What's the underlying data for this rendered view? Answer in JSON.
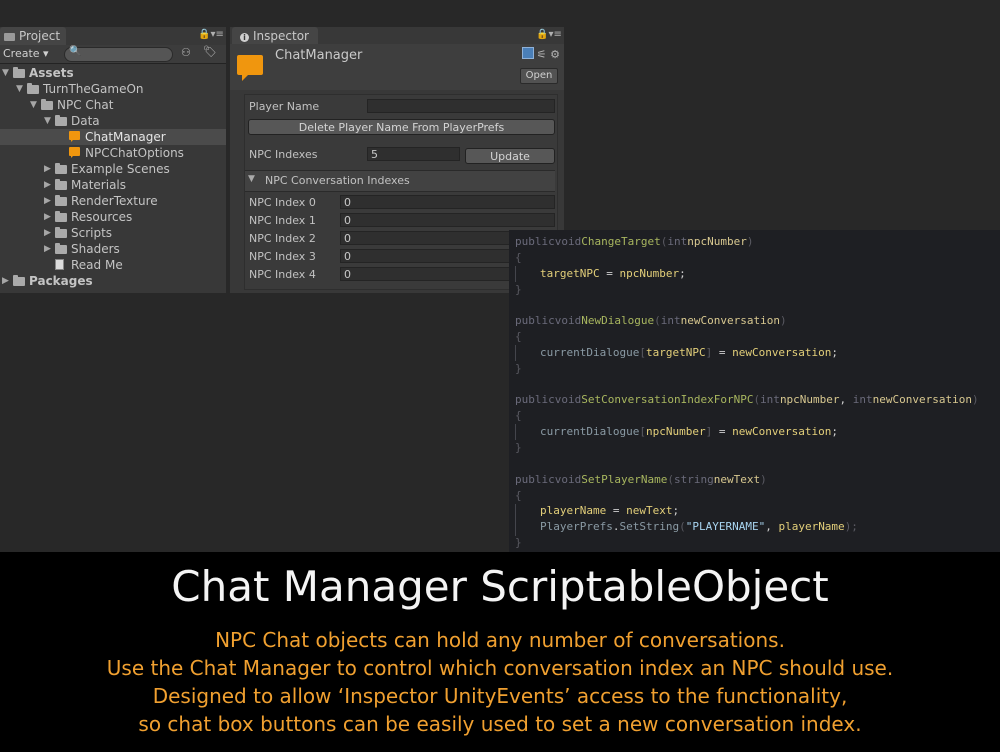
{
  "project": {
    "tab_label": "Project",
    "create_label": "Create",
    "tree": [
      {
        "label": "Assets",
        "depth": 0,
        "type": "folder",
        "bold": true
      },
      {
        "label": "TurnTheGameOn",
        "depth": 1,
        "type": "folder"
      },
      {
        "label": "NPC Chat",
        "depth": 2,
        "type": "folder"
      },
      {
        "label": "Data",
        "depth": 3,
        "type": "folder"
      },
      {
        "label": "ChatManager",
        "depth": 4,
        "type": "chat",
        "selected": true
      },
      {
        "label": "NPCChatOptions",
        "depth": 4,
        "type": "chat"
      },
      {
        "label": "Example Scenes",
        "depth": 3,
        "type": "folder-collapsed"
      },
      {
        "label": "Materials",
        "depth": 3,
        "type": "folder-collapsed"
      },
      {
        "label": "RenderTexture",
        "depth": 3,
        "type": "folder-collapsed"
      },
      {
        "label": "Resources",
        "depth": 3,
        "type": "folder-collapsed"
      },
      {
        "label": "Scripts",
        "depth": 3,
        "type": "folder-collapsed"
      },
      {
        "label": "Shaders",
        "depth": 3,
        "type": "folder-collapsed"
      },
      {
        "label": "Read Me",
        "depth": 3,
        "type": "doc"
      },
      {
        "label": "Packages",
        "depth": 0,
        "type": "folder-collapsed",
        "bold": true
      }
    ]
  },
  "inspector": {
    "tab_label": "Inspector",
    "asset_title": "ChatManager",
    "open_label": "Open",
    "player_name_label": "Player Name",
    "player_name_value": "",
    "delete_button": "Delete Player Name From PlayerPrefs",
    "npc_indexes_label": "NPC Indexes",
    "npc_indexes_value": "5",
    "update_button": "Update",
    "foldout_label": "NPC Conversation Indexes",
    "npc_index_rows": [
      {
        "label": "NPC Index 0",
        "value": "0"
      },
      {
        "label": "NPC Index 1",
        "value": "0"
      },
      {
        "label": "NPC Index 2",
        "value": "0"
      },
      {
        "label": "NPC Index 3",
        "value": "0"
      },
      {
        "label": "NPC Index 4",
        "value": "0"
      }
    ]
  },
  "code": {
    "m1_sig": [
      "public",
      "void",
      "ChangeTarget",
      "(",
      "int",
      "npcNumber",
      ")"
    ],
    "m1_body": [
      "targetNPC",
      " = ",
      "npcNumber",
      ";"
    ],
    "m2_sig": [
      "public",
      "void",
      "NewDialogue",
      "(",
      "int",
      "newConversation",
      ")"
    ],
    "m2_body": [
      "currentDialogue",
      "[",
      "targetNPC",
      "]",
      " = ",
      "newConversation",
      ";"
    ],
    "m3_sig": [
      "public",
      "void",
      "SetConversationIndexForNPC",
      "(",
      "int",
      "npcNumber",
      ", ",
      "int",
      "newConversation",
      ")"
    ],
    "m3_body": [
      "currentDialogue",
      "[",
      "npcNumber",
      "]",
      " = ",
      "newConversation",
      ";"
    ],
    "m4_sig": [
      "public",
      "void",
      "SetPlayerName",
      "(",
      "string",
      "newText",
      ")"
    ],
    "m4_body1": [
      "playerName",
      " = ",
      "newText",
      ";"
    ],
    "m4_body2": [
      "PlayerPrefs",
      ".",
      "SetString",
      "(",
      "\"PLAYERNAME\"",
      ", ",
      "playerName",
      ");"
    ],
    "open_brace": "{",
    "close_brace": "}"
  },
  "caption": {
    "title": "Chat Manager ScriptableObject",
    "lines": [
      "NPC Chat objects can hold any number of conversations.",
      "Use the Chat Manager to control which conversation index an NPC should use.",
      "Designed to allow ‘Inspector UnityEvents’ access to the functionality,",
      "so chat box buttons can be easily used to set a new conversation index."
    ]
  }
}
